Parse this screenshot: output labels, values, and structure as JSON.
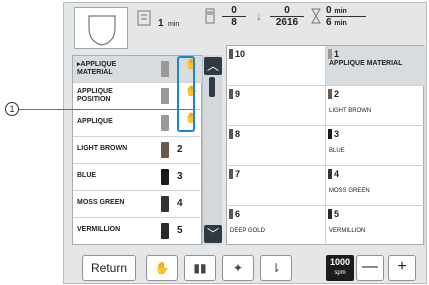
{
  "top": {
    "time_value": "1",
    "time_unit": "min",
    "count_current": "0",
    "count_total": "8",
    "stitch_current": "0",
    "stitch_total": "2616",
    "duration_current": "0",
    "duration_unit_current": "min",
    "duration_total": "6",
    "duration_unit_total": "min"
  },
  "list": {
    "rows": [
      {
        "label_line1": "APPLIQUE",
        "label_line2": "MATERIAL",
        "num": "",
        "selected": true
      },
      {
        "label_line1": "APPLIQUE",
        "label_line2": "POSITION",
        "num": ""
      },
      {
        "label_line1": "APPLIQUE",
        "label_line2": "",
        "num": ""
      },
      {
        "label_line1": "LIGHT BROWN",
        "label_line2": "",
        "num": "2"
      },
      {
        "label_line1": "BLUE",
        "label_line2": "",
        "num": "3"
      },
      {
        "label_line1": "MOSS GREEN",
        "label_line2": "",
        "num": "4"
      },
      {
        "label_line1": "VERMILLION",
        "label_line2": "",
        "num": "5"
      }
    ]
  },
  "grid": {
    "cells": [
      {
        "num": "10",
        "name": ""
      },
      {
        "num": "1",
        "name": "APPLIQUE MATERIAL"
      },
      {
        "num": "9",
        "name": ""
      },
      {
        "num": "2",
        "name": "LIGHT BROWN"
      },
      {
        "num": "8",
        "name": ""
      },
      {
        "num": "3",
        "name": "BLUE"
      },
      {
        "num": "7",
        "name": ""
      },
      {
        "num": "4",
        "name": "MOSS GREEN"
      },
      {
        "num": "6",
        "name": "DEEP GOLD"
      },
      {
        "num": "5",
        "name": "VERMILLION"
      }
    ]
  },
  "bottom": {
    "return_label": "Return",
    "speed_value": "1000",
    "speed_unit": "spm",
    "minus_label": "—",
    "plus_label": "+"
  },
  "callout": {
    "label": "1"
  },
  "icons": {
    "hand": "✋",
    "up": "⌃",
    "down": "⌄"
  },
  "colors": {
    "accent": "#1a88c9",
    "dark": "#2f3a44"
  }
}
